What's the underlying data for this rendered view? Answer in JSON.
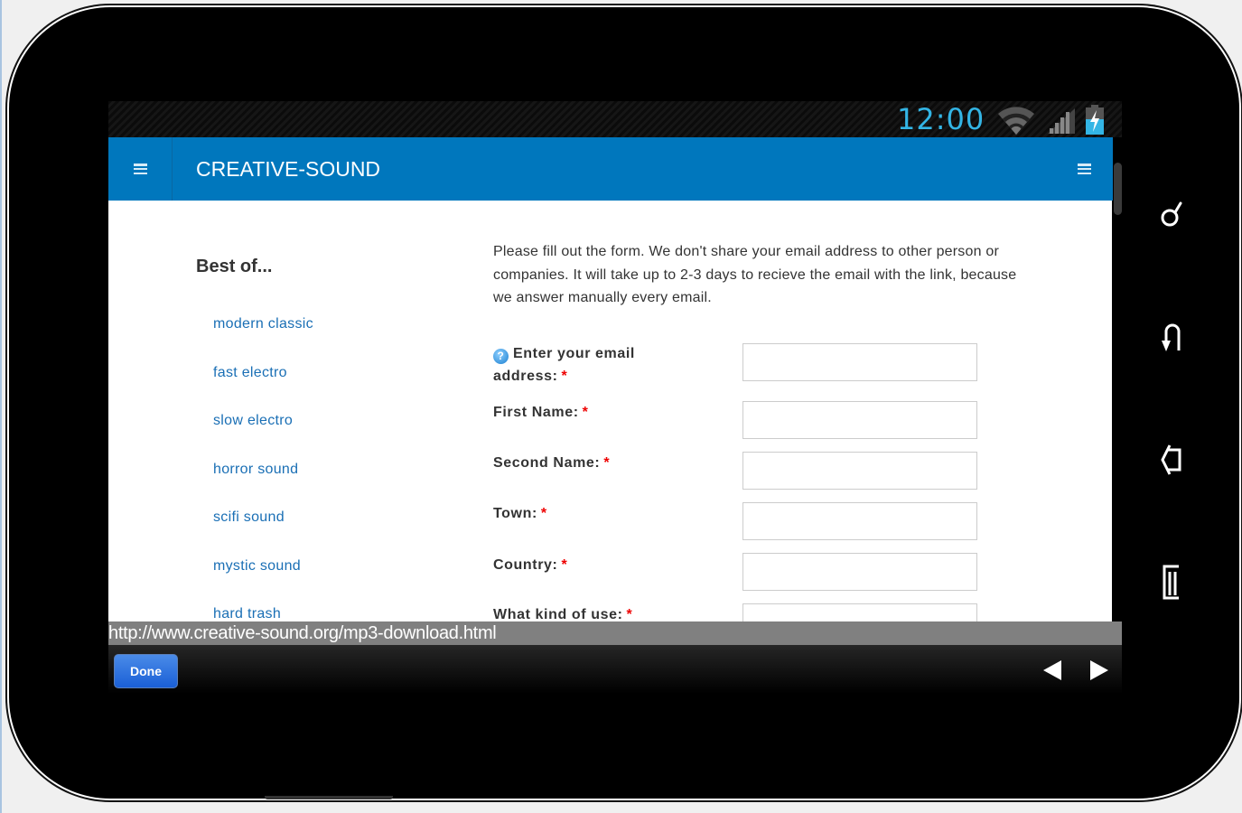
{
  "status_bar": {
    "time": "12:00",
    "icons": [
      "wifi-icon",
      "signal-icon",
      "battery-charging-icon"
    ]
  },
  "app": {
    "title": "CREATIVE-SOUND",
    "brand_color": "#0077bd",
    "left_menu_icon": "hamburger-menu-icon",
    "right_menu_icon": "hamburger-menu-icon"
  },
  "sidebar": {
    "title": "Best of...",
    "items": [
      {
        "label": "modern classic"
      },
      {
        "label": "fast electro"
      },
      {
        "label": "slow electro"
      },
      {
        "label": "horror sound"
      },
      {
        "label": "scifi sound"
      },
      {
        "label": "mystic sound"
      },
      {
        "label": "hard trash"
      }
    ]
  },
  "form": {
    "intro": "Please fill out the form. We don't share your email address to other person or companies. It will take up to 2-3 days to recieve the email with the link, because we answer manually every email.",
    "required_marker": "*",
    "help_icon_glyph": "?",
    "fields": [
      {
        "label": "Enter your email address:",
        "value": ""
      },
      {
        "label": "First Name:",
        "value": ""
      },
      {
        "label": "Second Name:",
        "value": ""
      },
      {
        "label": "Town:",
        "value": ""
      },
      {
        "label": "Country:",
        "value": ""
      },
      {
        "label": "What kind of use:",
        "value": ""
      }
    ]
  },
  "browser": {
    "url": "http://www.creative-sound.org/mp3-download.html",
    "done_label": "Done",
    "back_icon": "back-arrow-icon",
    "forward_icon": "forward-arrow-icon"
  },
  "device_keys": [
    "search-key-icon",
    "back-key-icon",
    "home-key-icon",
    "recent-apps-key-icon"
  ]
}
